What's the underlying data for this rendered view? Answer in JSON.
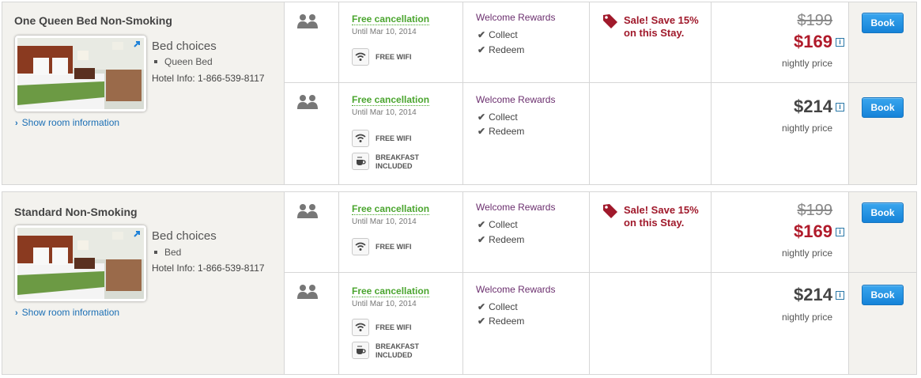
{
  "rooms": [
    {
      "title": "One Queen Bed Non-Smoking",
      "bed_choices_label": "Bed choices",
      "bed_type": "Queen Bed",
      "hotel_info": "Hotel Info: 1-866-539-8117",
      "show_room_label": "Show room information",
      "rates": [
        {
          "cancellation": "Free cancellation",
          "until": "Until Mar 10, 2014",
          "amenities": [
            "FREE WIFI"
          ],
          "rewards_title": "Welcome Rewards",
          "rewards": [
            "Collect",
            "Redeem"
          ],
          "sale_text": "Sale! Save 15% on this Stay.",
          "old_price": "$199",
          "price": "$169",
          "price_note": "nightly price",
          "book_label": "Book"
        },
        {
          "cancellation": "Free cancellation",
          "until": "Until Mar 10, 2014",
          "amenities": [
            "FREE WIFI",
            "BREAKFAST",
            "INCLUDED"
          ],
          "rewards_title": "Welcome Rewards",
          "rewards": [
            "Collect",
            "Redeem"
          ],
          "price": "$214",
          "price_note": "nightly price",
          "book_label": "Book"
        }
      ]
    },
    {
      "title": "Standard Non-Smoking",
      "bed_choices_label": "Bed choices",
      "bed_type": "Bed",
      "hotel_info": "Hotel Info: 1-866-539-8117",
      "show_room_label": "Show room information",
      "rates": [
        {
          "cancellation": "Free cancellation",
          "until": "Until Mar 10, 2014",
          "amenities": [
            "FREE WIFI"
          ],
          "rewards_title": "Welcome Rewards",
          "rewards": [
            "Collect",
            "Redeem"
          ],
          "sale_text": "Sale! Save 15% on this Stay.",
          "old_price": "$199",
          "price": "$169",
          "price_note": "nightly price",
          "book_label": "Book"
        },
        {
          "cancellation": "Free cancellation",
          "until": "Until Mar 10, 2014",
          "amenities": [
            "FREE WIFI",
            "BREAKFAST",
            "INCLUDED"
          ],
          "rewards_title": "Welcome Rewards",
          "rewards": [
            "Collect",
            "Redeem"
          ],
          "price": "$214",
          "price_note": "nightly price",
          "book_label": "Book"
        }
      ]
    }
  ],
  "info_icon_glyph": "i",
  "check_glyph": "✔",
  "chevron_glyph": "›",
  "colors": {
    "sale_red": "#b01a2a",
    "cancel_green": "#4aa52e",
    "rewards_purple": "#6b2f6e",
    "book_blue": "#1583d8",
    "link_blue": "#1b6fb5"
  },
  "icons": [
    "guests-icon",
    "wifi-icon",
    "coffee-cup-icon",
    "sale-tag-icon",
    "expand-arrow-icon",
    "info-icon",
    "checkmark-icon",
    "chevron-right-icon"
  ]
}
